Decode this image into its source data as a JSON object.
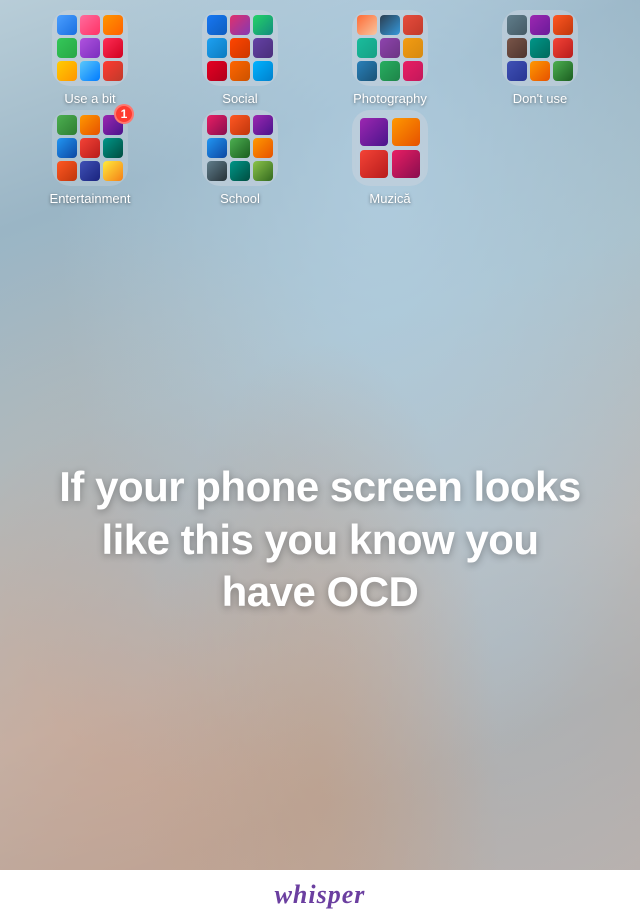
{
  "folders": {
    "row1": [
      {
        "id": "use-a-bit",
        "label": "Use a bit"
      },
      {
        "id": "social",
        "label": "Social"
      },
      {
        "id": "photography",
        "label": "Photography"
      },
      {
        "id": "dont-use",
        "label": "Don't use"
      }
    ],
    "row2": [
      {
        "id": "entertainment",
        "label": "Entertainment",
        "badge": "1"
      },
      {
        "id": "school",
        "label": "School"
      },
      {
        "id": "muzica",
        "label": "Muzică"
      }
    ]
  },
  "main_text": "If your phone screen looks like this you know you have OCD",
  "whisper_label": "whisper"
}
